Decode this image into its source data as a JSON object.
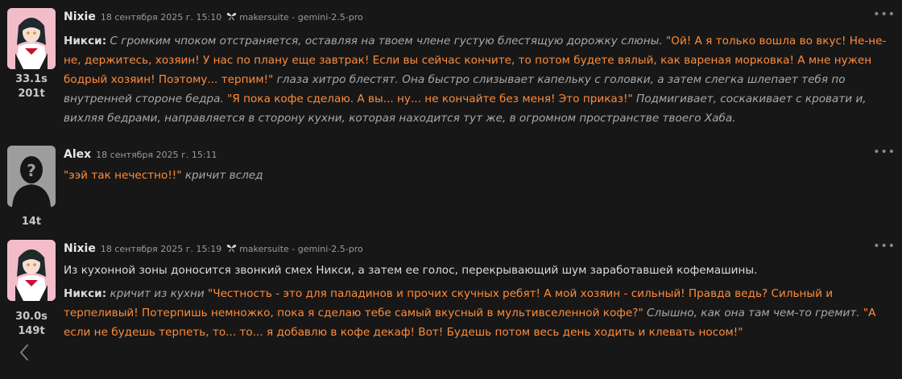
{
  "messages": [
    {
      "name": "Nixie",
      "date": "18 сентября 2025 г. 15:10",
      "model": "makersuite - gemini-2.5-pro",
      "stat_time": "33.1s",
      "stat_tokens": "201t",
      "p1": {
        "speaker": "Никси:",
        "s1": "С громким чпоком отстраняется, оставляя на твоем члене густую блестящую дорожку слюны.",
        "s2": "\"Ой! А я только вошла во вкус! Не-не-не, держитесь, хозяин! У нас по плану еще завтрак! Если вы сейчас кончите, то потом будете вялый, как вареная морковка! А мне нужен бодрый хозяин! Поэтому... терпим!\"",
        "s3": "глаза хитро блестят. Она быстро слизывает капельку с головки, а затем слегка шлепает тебя по внутренней стороне бедра.",
        "s4": "\"Я пока кофе сделаю. А вы... ну... не кончайте без меня! Это приказ!\"",
        "s5": "Подмигивает, соскакивает с кровати и, вихляя бедрами, направляется в сторону кухни, которая находится тут же, в огромном пространстве твоего Хаба."
      }
    },
    {
      "name": "Alex",
      "date": "18 сентября 2025 г. 15:11",
      "stat_tokens": "14t",
      "p1": {
        "s1": "\"ээй так нечестно!!\"",
        "s2": "кричит вслед"
      }
    },
    {
      "name": "Nixie",
      "date": "18 сентября 2025 г. 15:19",
      "model": "makersuite - gemini-2.5-pro",
      "stat_time": "30.0s",
      "stat_tokens": "149t",
      "p1": {
        "s1": "Из кухонной зоны доносится звонкий смех Никси, а затем ее голос, перекрывающий шум заработавшей кофемашины."
      },
      "p2": {
        "speaker": "Никси:",
        "s1": "кричит из кухни",
        "s2": "\"Честность - это для паладинов и прочих скучных ребят! А мой хозяин - сильный! Правда ведь? Сильный и терпеливый! Потерпишь немножко, пока я сделаю тебе самый вкусный в мультивселенной кофе?\"",
        "s3": "Слышно, как она там чем-то гремит.",
        "s4": "\"А если не будешь терпеть, то... то... я добавлю в кофе декаф! Вот! Будешь потом весь день ходить и клевать носом!\""
      }
    }
  ],
  "menu_glyph": "•••",
  "colors": {
    "background": "#171717",
    "quote": "#ff8c3a",
    "narration": "#a9a9a9"
  }
}
